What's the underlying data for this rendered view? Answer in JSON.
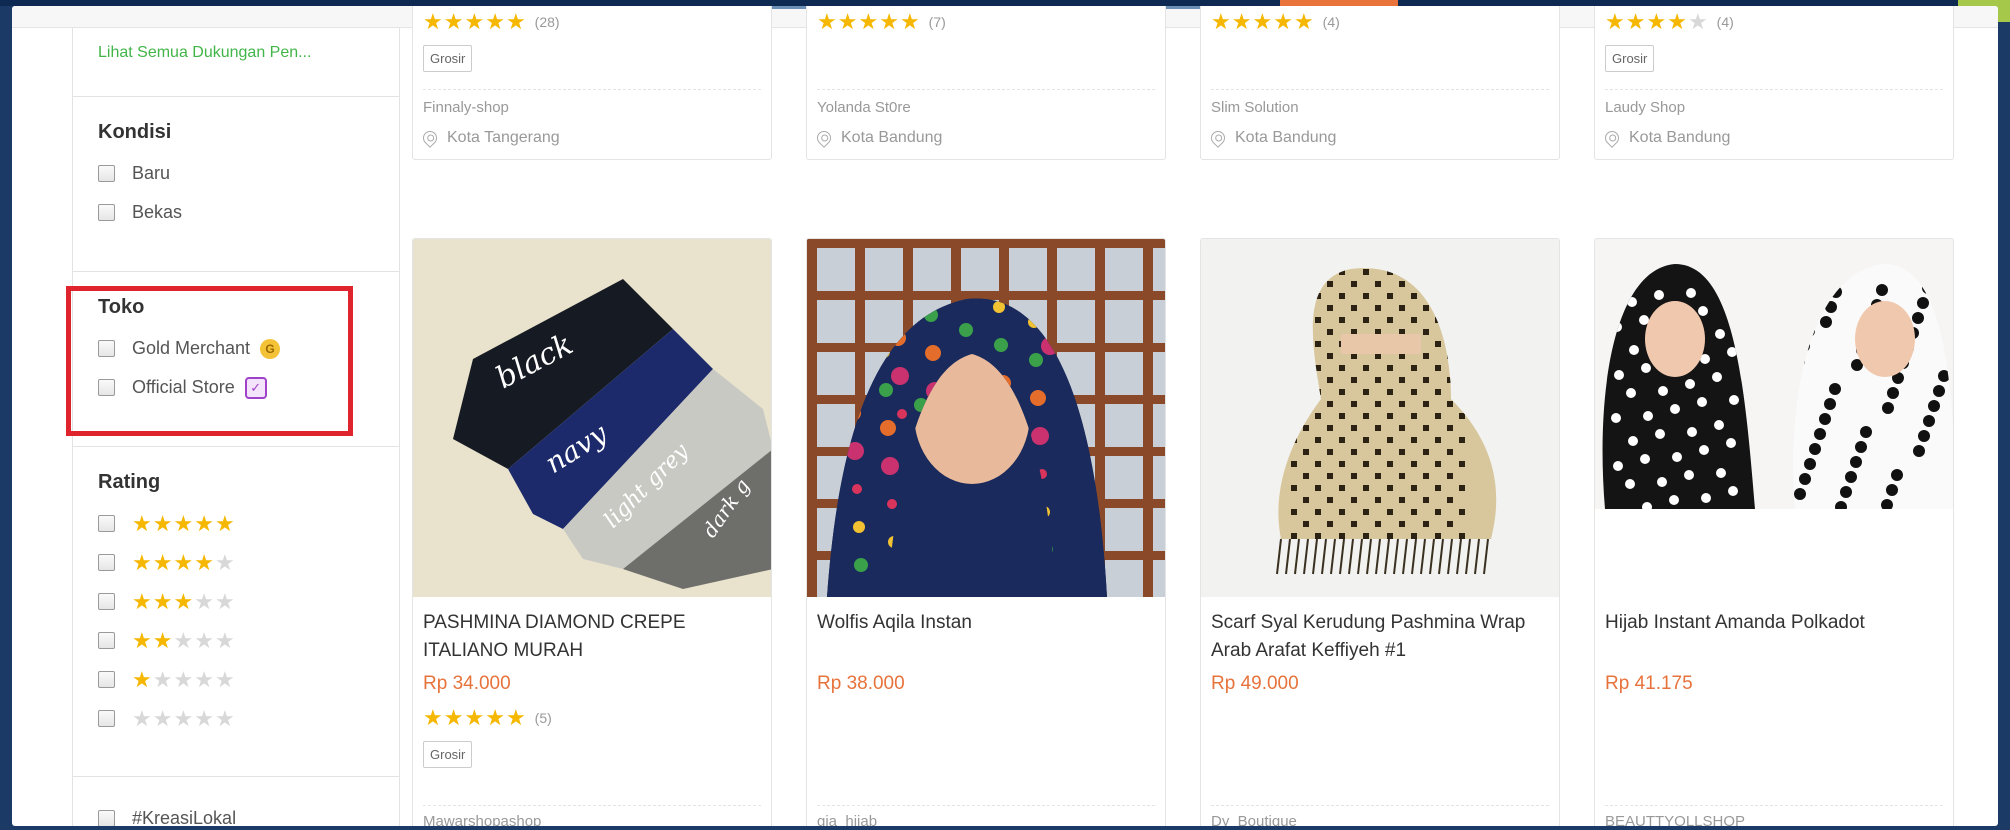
{
  "colors": {
    "accent_green": "#42b549",
    "price_orange": "#e7733c",
    "star_yellow": "#f6b700",
    "highlight_red": "#e0242e"
  },
  "sidebar": {
    "support_link": "Lihat Semua Dukungan Pen...",
    "kondisi": {
      "title": "Kondisi",
      "options": [
        "Baru",
        "Bekas"
      ]
    },
    "toko": {
      "title": "Toko",
      "gold_merchant": "Gold Merchant",
      "official_store": "Official Store"
    },
    "rating": {
      "title": "Rating",
      "levels": [
        5,
        4,
        3,
        2,
        1,
        0
      ]
    },
    "kreasi": "#KreasiLokal"
  },
  "top_products": [
    {
      "rating": 5,
      "reviews": "(28)",
      "grosir": "Grosir",
      "shop": "Finnaly-shop",
      "location": "Kota Tangerang"
    },
    {
      "rating": 5,
      "reviews": "(7)",
      "grosir": "",
      "shop": "Yolanda St0re",
      "location": "Kota Bandung"
    },
    {
      "rating": 5,
      "reviews": "(4)",
      "grosir": "",
      "shop": "Slim Solution",
      "location": "Kota Bandung"
    },
    {
      "rating": 4,
      "reviews": "(4)",
      "grosir": "Grosir",
      "shop": "Laudy Shop",
      "location": "Kota Bandung"
    }
  ],
  "products": [
    {
      "name": "PASHMINA DIAMOND CREPE ITALIANO MURAH",
      "price": "Rp 34.000",
      "rating": 5,
      "reviews": "(5)",
      "grosir": "Grosir",
      "shop": "Mawarshopashop",
      "image_words": [
        "black",
        "navy",
        "light grey",
        "dark g"
      ]
    },
    {
      "name": "Wolfis Aqila Instan",
      "price": "Rp 38.000",
      "rating": null,
      "reviews": "",
      "grosir": "",
      "shop": "gia_hijab"
    },
    {
      "name": "Scarf Syal Kerudung Pashmina Wrap Arab Arafat Keffiyeh #1",
      "price": "Rp 49.000",
      "rating": null,
      "reviews": "",
      "grosir": "",
      "shop": "Dy_Boutique"
    },
    {
      "name": "Hijab Instant Amanda Polkadot",
      "price": "Rp 41.175",
      "rating": null,
      "reviews": "",
      "grosir": "",
      "shop": "BEAUTTYOLLSHOP"
    }
  ]
}
